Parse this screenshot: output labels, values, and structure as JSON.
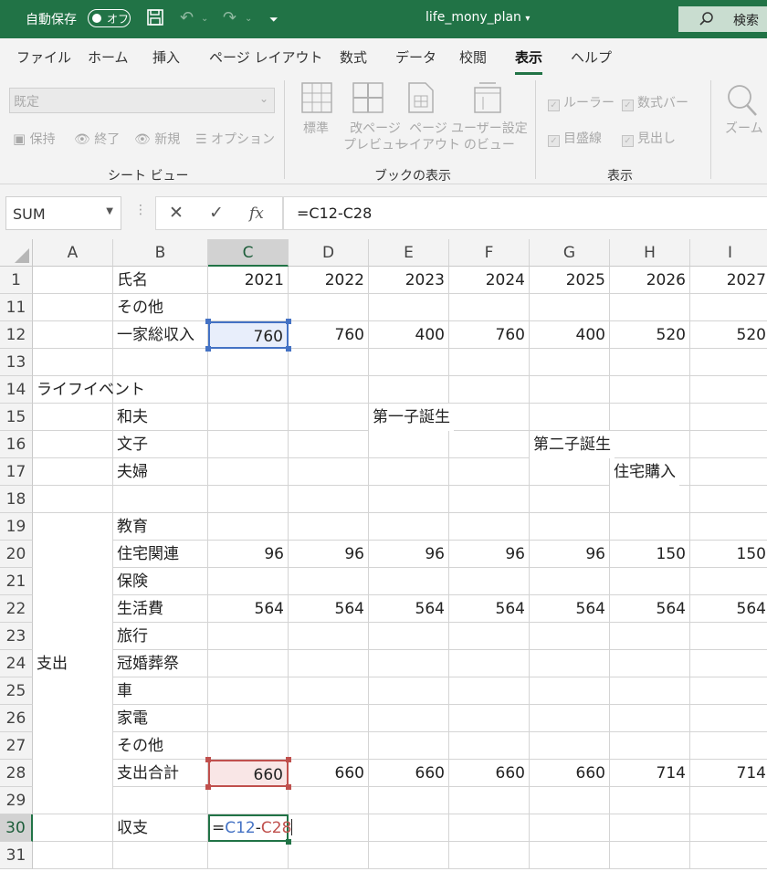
{
  "titlebar": {
    "autosave_label": "自動保存",
    "autosave_state": "オフ",
    "filename": "life_mony_plan",
    "filename_chevron": "▾",
    "search_label": "検索"
  },
  "ribbon_tabs": [
    "ファイル",
    "ホーム",
    "挿入",
    "ページ レイアウト",
    "数式",
    "データ",
    "校閲",
    "表示",
    "ヘルプ"
  ],
  "active_tab": "表示",
  "ribbon": {
    "sheet_view": {
      "dropdown_value": "既定",
      "keep": "保持",
      "exit": "終了",
      "new": "新規",
      "options": "オプション",
      "group_label": "シート ビュー"
    },
    "workbook_views": {
      "normal": "標準",
      "page_break_1": "改ページ",
      "page_break_2": "プレビュー",
      "page_layout_1": "ページ",
      "page_layout_2": "レイアウト",
      "custom_1": "ユーザー設定",
      "custom_2": "のビュー",
      "group_label": "ブックの表示"
    },
    "show": {
      "ruler": "ルーラー",
      "formula_bar": "数式バー",
      "gridlines": "目盛線",
      "headings": "見出し",
      "group_label": "表示"
    },
    "zoom": {
      "label": "ズーム"
    }
  },
  "formula_bar": {
    "name_box": "SUM",
    "fx": "fx",
    "formula": "=C12-C28"
  },
  "grid": {
    "columns": [
      "A",
      "B",
      "C",
      "D",
      "E",
      "F",
      "G",
      "H",
      "I"
    ],
    "selected_column": "C",
    "selected_row": "30",
    "rows": [
      {
        "num": "1",
        "A": "",
        "B": "氏名",
        "values": [
          "2021",
          "2022",
          "2023",
          "2024",
          "2025",
          "2026",
          "2027"
        ]
      },
      {
        "num": "11",
        "A": "",
        "B": "その他",
        "values": [
          "",
          "",
          "",
          "",
          "",
          "",
          ""
        ]
      },
      {
        "num": "12",
        "A": "",
        "B": "一家総収入",
        "values": [
          "760",
          "760",
          "400",
          "760",
          "400",
          "520",
          "520"
        ]
      },
      {
        "num": "13",
        "A": "",
        "B": "",
        "values": [
          "",
          "",
          "",
          "",
          "",
          "",
          ""
        ]
      },
      {
        "num": "14",
        "A": "ライフイベント",
        "B": "",
        "values": [
          "",
          "",
          "",
          "",
          "",
          "",
          ""
        ]
      },
      {
        "num": "15",
        "A": "",
        "B": "和夫",
        "values": [
          "",
          "",
          "第一子誕生",
          "",
          "",
          "",
          ""
        ]
      },
      {
        "num": "16",
        "A": "",
        "B": "文子",
        "values": [
          "",
          "",
          "",
          "",
          "第二子誕生",
          "",
          ""
        ]
      },
      {
        "num": "17",
        "A": "",
        "B": "夫婦",
        "values": [
          "",
          "",
          "",
          "",
          "",
          "住宅購入",
          ""
        ]
      },
      {
        "num": "18",
        "A": "",
        "B": "",
        "values": [
          "",
          "",
          "",
          "",
          "",
          "",
          ""
        ]
      },
      {
        "num": "19",
        "A": "",
        "B": "教育",
        "values": [
          "",
          "",
          "",
          "",
          "",
          "",
          ""
        ]
      },
      {
        "num": "20",
        "A": "",
        "B": "住宅関連",
        "values": [
          "96",
          "96",
          "96",
          "96",
          "96",
          "150",
          "150"
        ]
      },
      {
        "num": "21",
        "A": "",
        "B": "保険",
        "values": [
          "",
          "",
          "",
          "",
          "",
          "",
          ""
        ]
      },
      {
        "num": "22",
        "A": "",
        "B": "生活費",
        "values": [
          "564",
          "564",
          "564",
          "564",
          "564",
          "564",
          "564"
        ]
      },
      {
        "num": "23",
        "A": "",
        "B": "旅行",
        "values": [
          "",
          "",
          "",
          "",
          "",
          "",
          ""
        ]
      },
      {
        "num": "24",
        "A": "",
        "B": "冠婚葬祭",
        "values": [
          "",
          "",
          "",
          "",
          "",
          "",
          ""
        ]
      },
      {
        "num": "25",
        "A": "",
        "B": "車",
        "values": [
          "",
          "",
          "",
          "",
          "",
          "",
          ""
        ]
      },
      {
        "num": "26",
        "A": "",
        "B": "家電",
        "values": [
          "",
          "",
          "",
          "",
          "",
          "",
          ""
        ]
      },
      {
        "num": "27",
        "A": "",
        "B": "その他",
        "values": [
          "",
          "",
          "",
          "",
          "",
          "",
          ""
        ]
      },
      {
        "num": "28",
        "A": "",
        "B": "支出合計",
        "values": [
          "660",
          "660",
          "660",
          "660",
          "660",
          "714",
          "714"
        ]
      },
      {
        "num": "29",
        "A": "",
        "B": "",
        "values": [
          "",
          "",
          "",
          "",
          "",
          "",
          ""
        ]
      },
      {
        "num": "30",
        "A": "",
        "B": "収支",
        "values": [
          "",
          "",
          "",
          "",
          "",
          "",
          ""
        ]
      },
      {
        "num": "31",
        "A": "",
        "B": "",
        "values": [
          "",
          "",
          "",
          "",
          "",
          "",
          ""
        ]
      }
    ],
    "merged_label": "支出",
    "editing_cell": {
      "eq": "=",
      "ref1": "C12",
      "minus": "-",
      "ref2": "C28"
    }
  },
  "colors": {
    "excel_green": "#217346",
    "ref_blue": "#4472c4",
    "ref_red": "#c0504d"
  }
}
